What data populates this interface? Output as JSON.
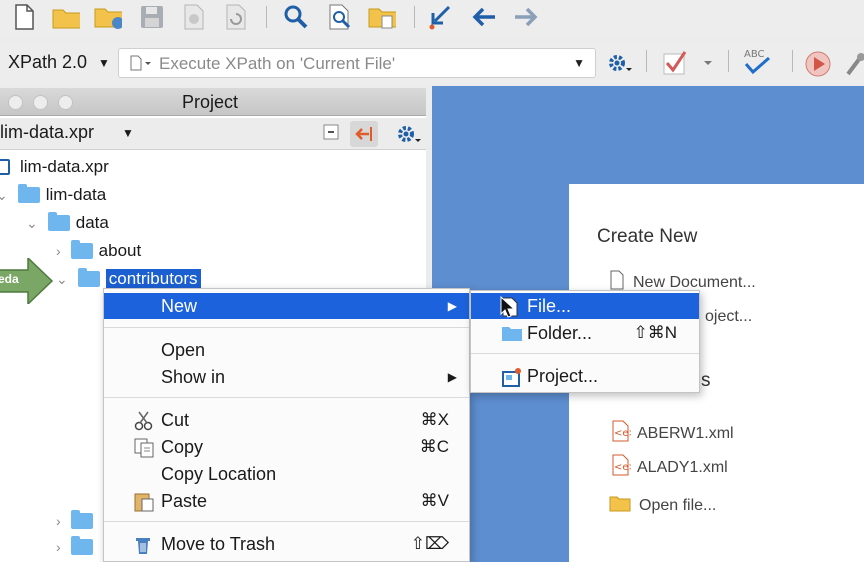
{
  "toolbar": {
    "xpath_version": "XPath 2.0",
    "xpath_placeholder": "Execute XPath on  'Current File'"
  },
  "project": {
    "title": "Project",
    "selector": "lim-data.xpr",
    "tree": [
      {
        "label": "lim-data.xpr",
        "type": "project"
      },
      {
        "label": "lim-data",
        "type": "folder"
      },
      {
        "label": "data",
        "type": "folder"
      },
      {
        "label": "about",
        "type": "folder"
      },
      {
        "label": "contributors",
        "type": "folder",
        "selected": true
      }
    ],
    "badge_text": "eda"
  },
  "context_menu": {
    "new": "New",
    "open": "Open",
    "show_in": "Show in",
    "cut": "Cut",
    "cut_sc": "⌘X",
    "copy": "Copy",
    "copy_sc": "⌘C",
    "copy_location": "Copy Location",
    "paste": "Paste",
    "paste_sc": "⌘V",
    "trash": "Move to Trash",
    "trash_sc": "⇧⌦"
  },
  "submenu": {
    "file": "File...",
    "folder": "Folder...",
    "folder_sc": "⇧⌘N",
    "project": "Project..."
  },
  "welcome": {
    "create_new": "Create New",
    "new_document": "New Document...",
    "new_project_partial": "oject...",
    "recent_partial": "s",
    "recent_files": [
      "ABERW1.xml",
      "ALADY1.xml"
    ],
    "open_file": "Open file..."
  },
  "colors": {
    "selection": "#1b62dc",
    "pane_blue": "#5d8ed0",
    "folder": "#6fb6ee"
  }
}
